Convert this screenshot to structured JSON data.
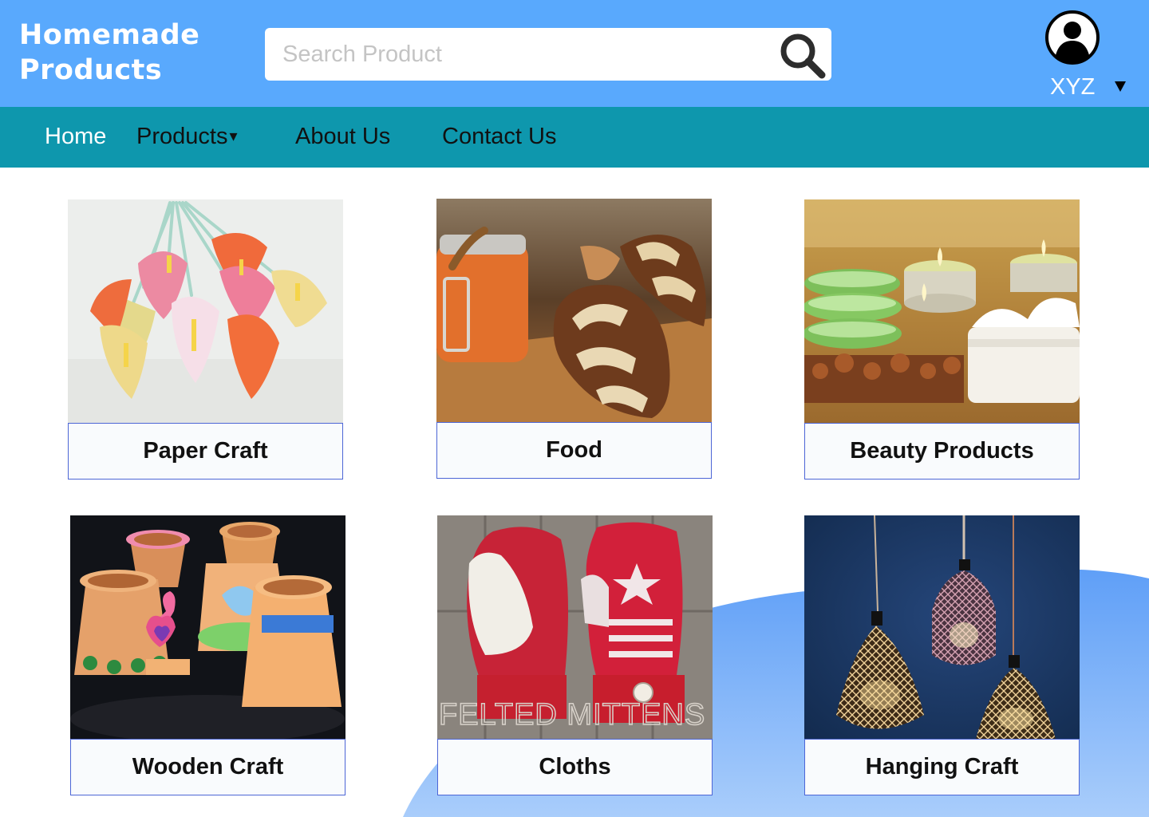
{
  "header": {
    "logo_line1": "Homemade",
    "logo_line2": "Products",
    "search_placeholder": "Search Product",
    "user_name": "XYZ"
  },
  "nav": {
    "home": "Home",
    "products": "Products",
    "products_caret": "▾",
    "about": "About Us",
    "contact": "Contact Us"
  },
  "categories": [
    {
      "label": "Paper Craft"
    },
    {
      "label": "Food"
    },
    {
      "label": "Beauty Products"
    },
    {
      "label": "Wooden Craft"
    },
    {
      "label": "Cloths"
    },
    {
      "label": "Hanging Craft"
    }
  ],
  "images": {
    "cloths_watermark": "FELTED MITTENS"
  },
  "colors": {
    "header_bg": "#59a9fd",
    "nav_bg": "#0e97ad",
    "card_border": "#4d66d6",
    "card_label_bg": "#f9fbfd"
  },
  "icons": {
    "search": "search-icon",
    "user": "user-avatar-icon",
    "dropdown": "caret-down-icon"
  }
}
